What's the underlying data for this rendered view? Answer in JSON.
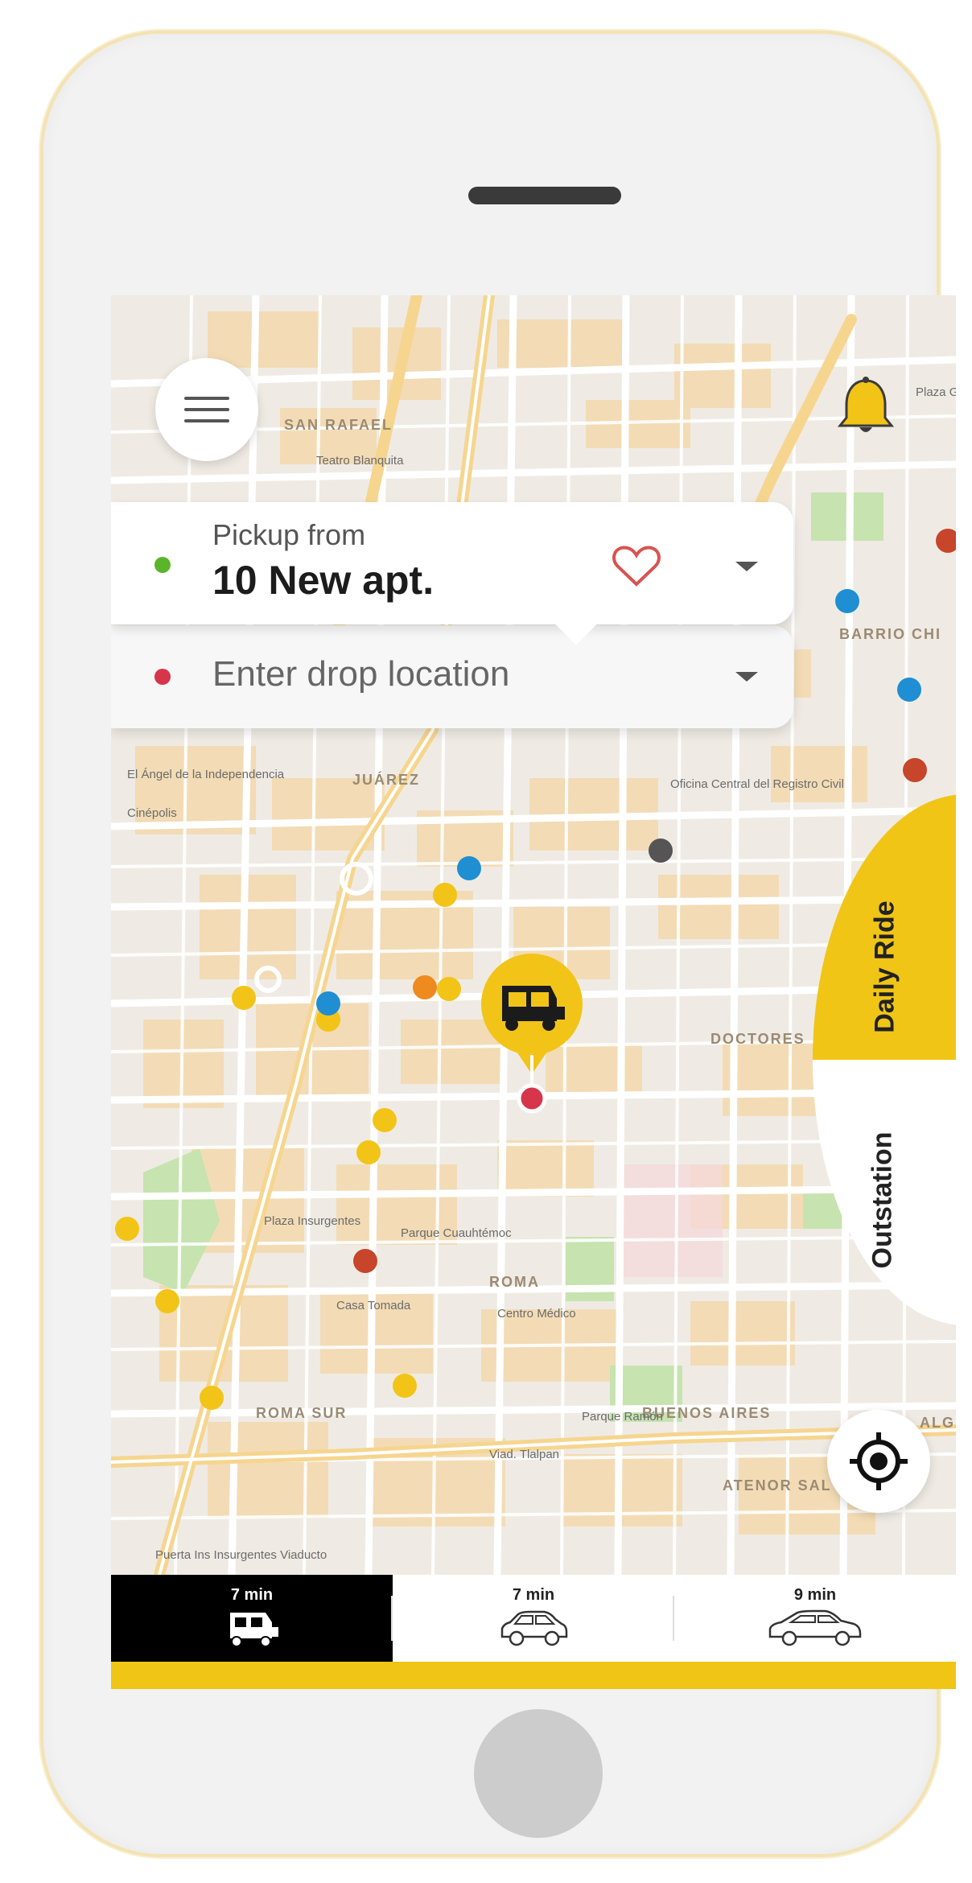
{
  "map": {
    "neighborhoods": [
      "SAN RAFAEL",
      "JUÁREZ",
      "BARRIO CHI",
      "DOCTORES",
      "ROMA",
      "ROMA SUR",
      "BUENOS AIRES",
      "ATENOR SAL",
      "ALGA"
    ],
    "labels": [
      "Teatro Blanquita",
      "Plaza G",
      "El Ángel de la Independencia",
      "Cinépolis",
      "Oficina Central del Registro Civil",
      "Parque Cuauhtémoc",
      "Plaza Insurgentes",
      "Casa Tomada",
      "Centro Médico",
      "Parque Ramón",
      "Puerta Ins Insurgentes Viaducto",
      "Viad. Tlalpan"
    ]
  },
  "search": {
    "pickup_caption": "Pickup from",
    "pickup_value": "10 New apt.",
    "drop_placeholder": "Enter drop location"
  },
  "ride_types": {
    "daily": "Daily Ride",
    "outstation": "Outstation"
  },
  "vehicles": [
    {
      "eta": "7 min",
      "icon": "auto-rickshaw-icon",
      "selected": true
    },
    {
      "eta": "7 min",
      "icon": "hatchback-car-icon",
      "selected": false
    },
    {
      "eta": "9 min",
      "icon": "sedan-car-icon",
      "selected": false
    }
  ],
  "colors": {
    "accent": "#f0c516",
    "pickup_dot": "#5bb52a",
    "drop_dot": "#d6354a",
    "heart": "#d9534f"
  }
}
